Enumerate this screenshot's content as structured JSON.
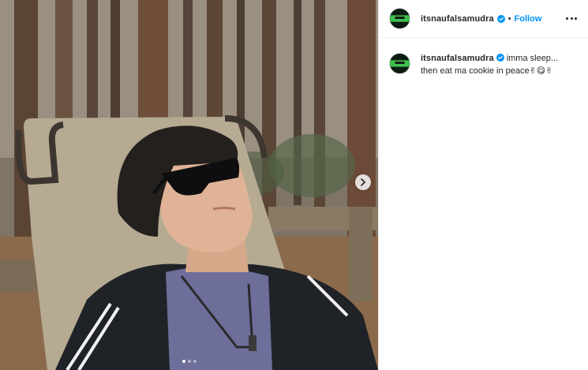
{
  "post": {
    "username": "itsnaufalsamudra",
    "follow_label": "Follow",
    "separator": "•",
    "caption_line1": "imma sleep...",
    "caption_line2": "then eat ma cookie in peace✌😋✌",
    "carousel": {
      "total": 3,
      "active": 1
    }
  },
  "icons": {
    "verified": "verified-badge-icon",
    "more": "more-options-icon",
    "next": "chevron-right-icon"
  },
  "colors": {
    "link_blue": "#0095f6",
    "verified_blue": "#0095f6",
    "text": "#262626",
    "divider": "#efefef"
  }
}
